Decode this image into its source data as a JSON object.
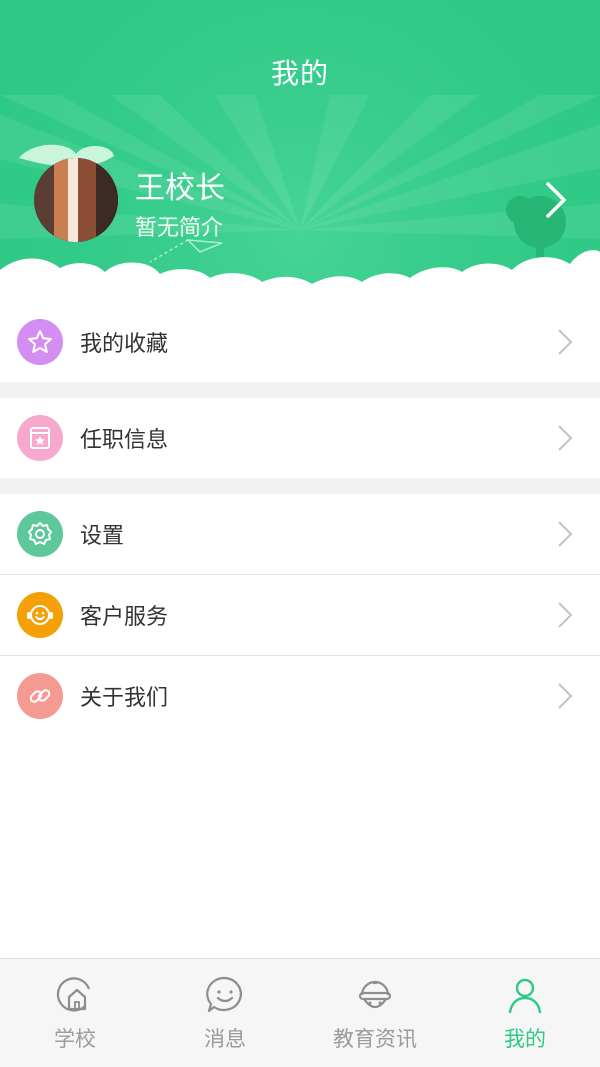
{
  "header": {
    "title": "我的",
    "user_name": "王校长",
    "user_bio": "暂无简介",
    "accent_color": "#2fc986"
  },
  "menu": {
    "favorites": {
      "label": "我的收藏",
      "icon": "star-icon",
      "color": "#d48ef2"
    },
    "position": {
      "label": "任职信息",
      "icon": "certificate-icon",
      "color": "#f7a8cd"
    },
    "settings": {
      "label": "设置",
      "icon": "gear-icon",
      "color": "#5ec89c"
    },
    "service": {
      "label": "客户服务",
      "icon": "headset-icon",
      "color": "#f4a007"
    },
    "about": {
      "label": "关于我们",
      "icon": "link-icon",
      "color": "#f59a92"
    }
  },
  "tabbar": {
    "tabs": [
      {
        "label": "学校",
        "icon": "school-home-icon",
        "active": false
      },
      {
        "label": "消息",
        "icon": "message-icon",
        "active": false
      },
      {
        "label": "教育资讯",
        "icon": "news-icon",
        "active": false
      },
      {
        "label": "我的",
        "icon": "profile-icon",
        "active": true
      }
    ]
  }
}
